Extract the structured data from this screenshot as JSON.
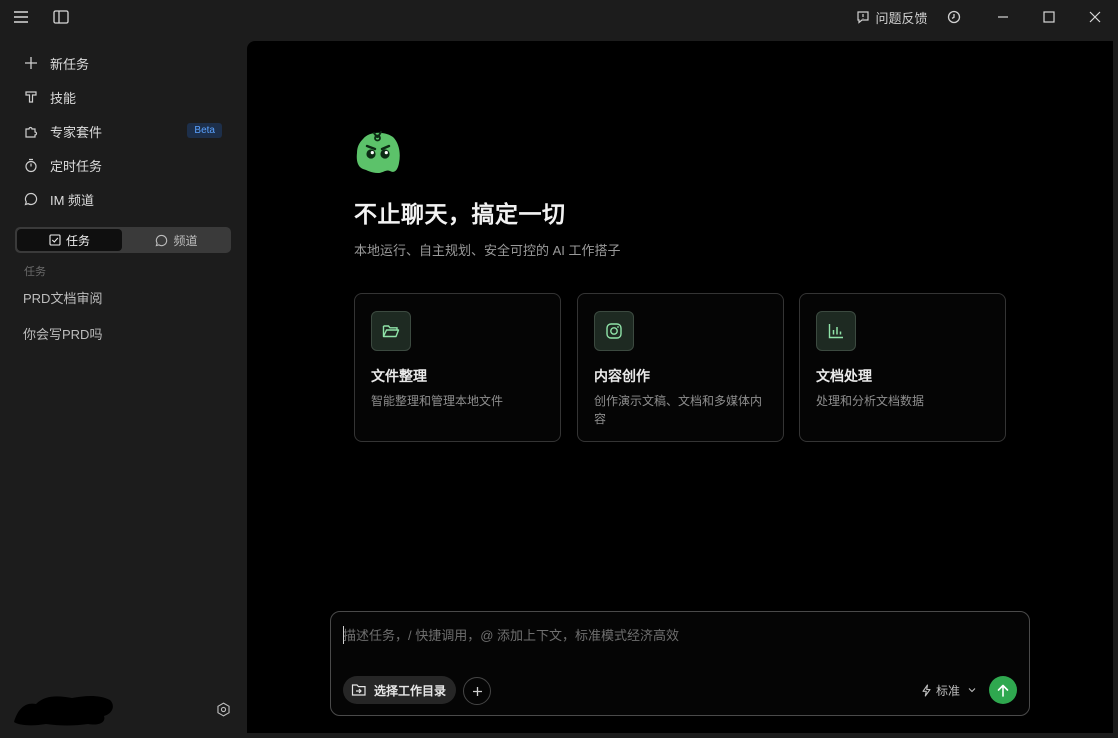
{
  "titlebar": {
    "feedback_label": "问题反馈"
  },
  "sidebar": {
    "nav": [
      {
        "label": "新任务",
        "icon": "plus-icon"
      },
      {
        "label": "技能",
        "icon": "brush-icon"
      },
      {
        "label": "专家套件",
        "icon": "puzzle-icon",
        "badge": "Beta"
      },
      {
        "label": "定时任务",
        "icon": "timer-icon"
      },
      {
        "label": "IM 频道",
        "icon": "chat-bubble-icon"
      }
    ],
    "segment": {
      "tasks_label": "任务",
      "channels_label": "频道"
    },
    "section_label": "任务",
    "tasks": [
      {
        "label": "PRD文档审阅"
      },
      {
        "label": "你会写PRD吗"
      }
    ]
  },
  "main": {
    "title": "不止聊天，搞定一切",
    "subtitle": "本地运行、自主规划、安全可控的 AI 工作搭子",
    "cards": [
      {
        "title": "文件整理",
        "desc": "智能整理和管理本地文件",
        "icon": "folder-open-icon"
      },
      {
        "title": "内容创作",
        "desc": "创作演示文稿、文档和多媒体内容",
        "icon": "instagram-icon"
      },
      {
        "title": "文档处理",
        "desc": "处理和分析文档数据",
        "icon": "bar-chart-icon"
      }
    ]
  },
  "composer": {
    "placeholder": "描述任务，/ 快捷调用，@ 添加上下文，标准模式经济高效",
    "dir_label": "选择工作目录",
    "mode_label": "标准"
  },
  "colors": {
    "accent_green": "#2fa84f",
    "beta_blue": "#5aa2ff",
    "logo_green": "#5cc26a"
  }
}
